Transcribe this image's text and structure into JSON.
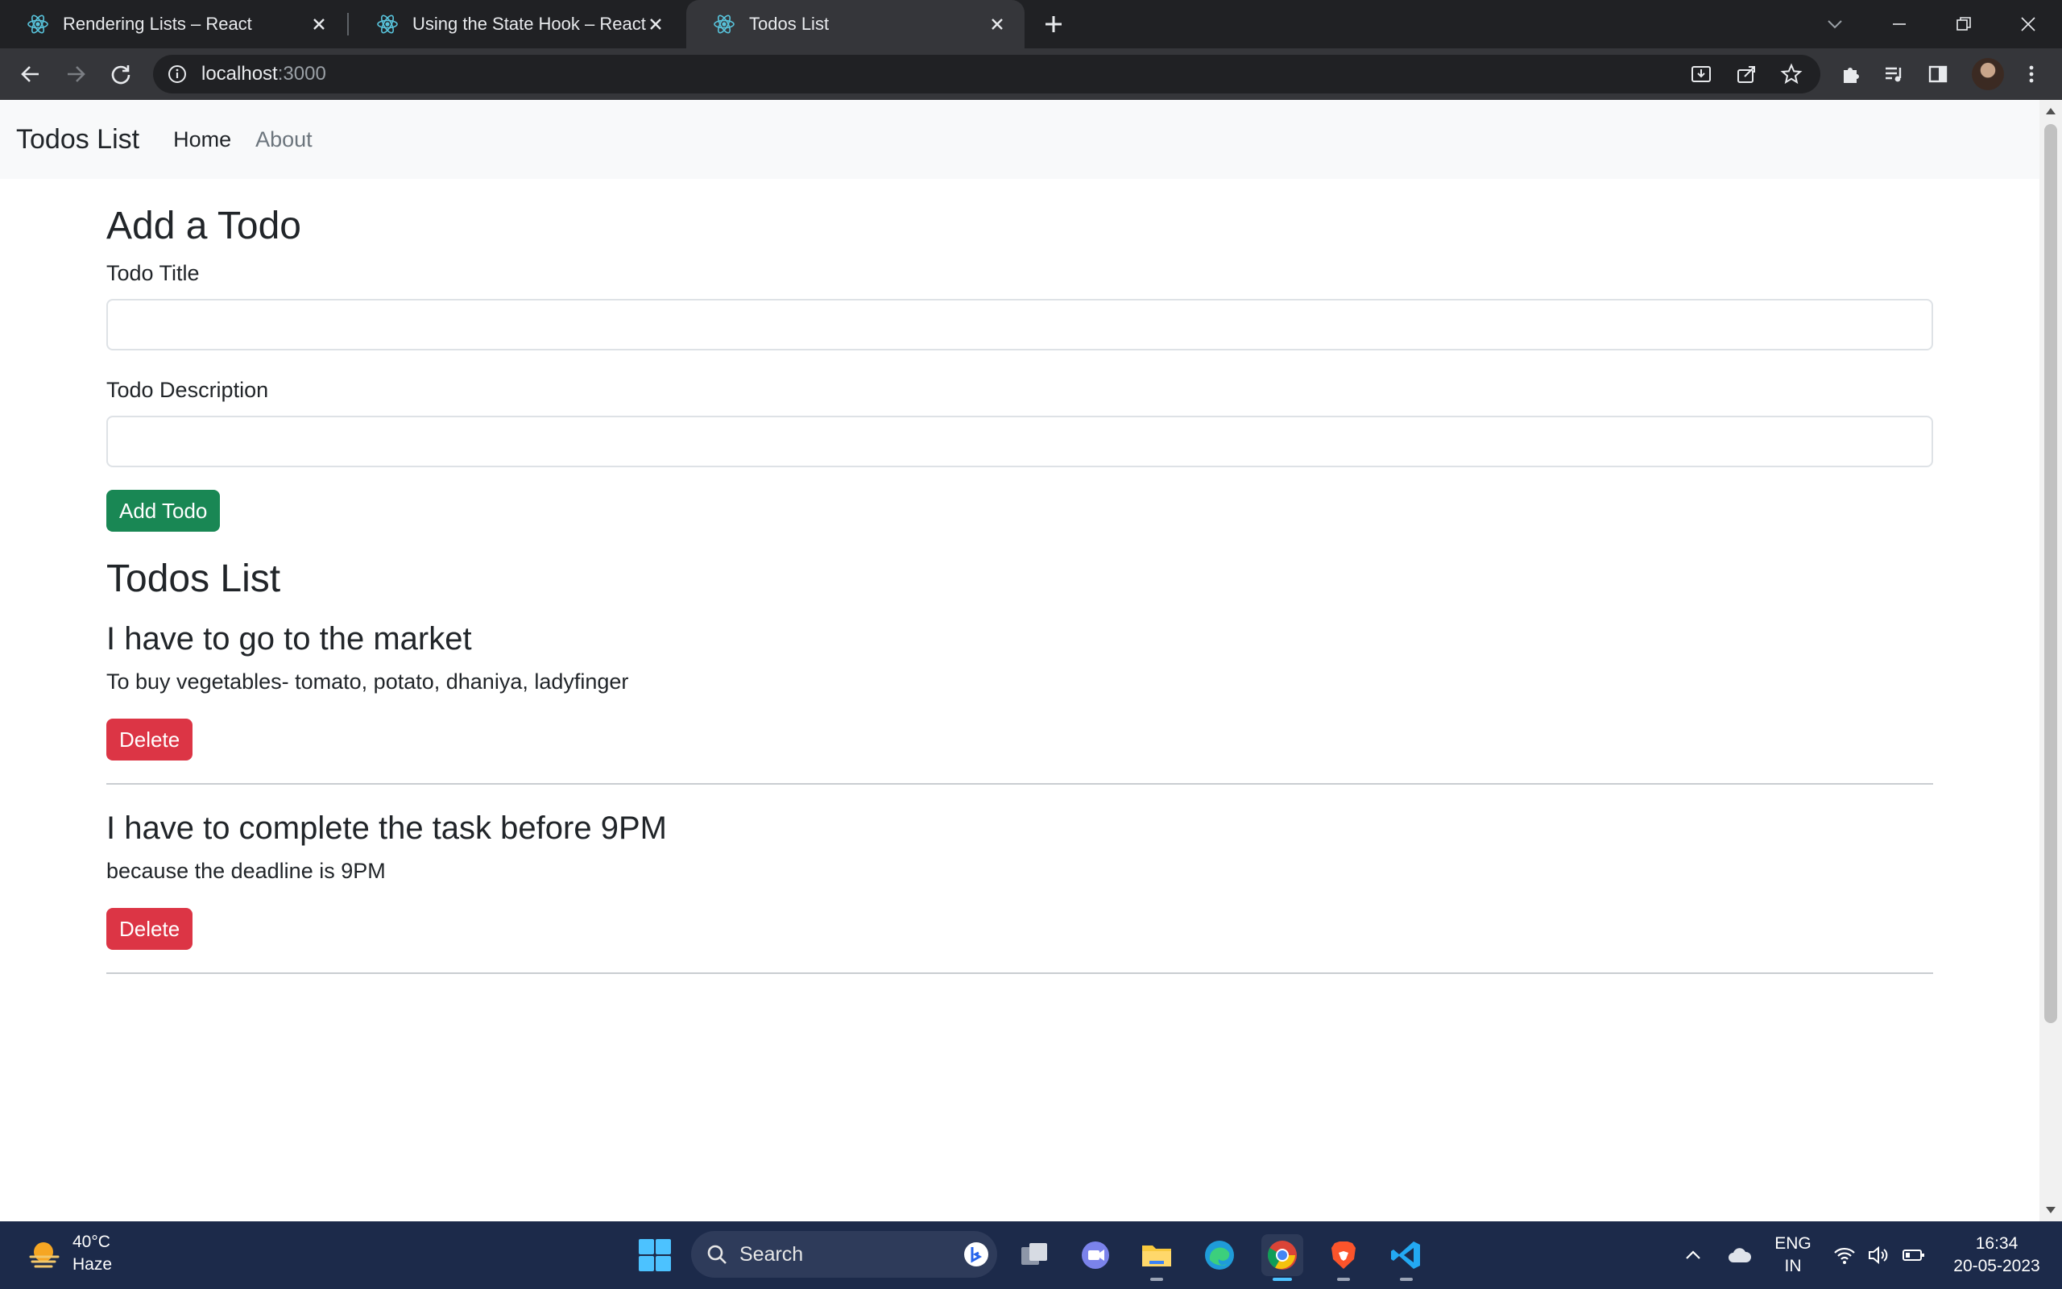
{
  "browser": {
    "tabs": [
      {
        "title": "Rendering Lists – React",
        "active": false
      },
      {
        "title": "Using the State Hook – React",
        "active": false
      },
      {
        "title": "Todos List",
        "active": true
      }
    ],
    "url_host": "localhost",
    "url_port": ":3000"
  },
  "navbar": {
    "brand": "Todos List",
    "links": [
      {
        "label": "Home",
        "active": true
      },
      {
        "label": "About",
        "active": false
      }
    ]
  },
  "add_form": {
    "heading": "Add a Todo",
    "title_label": "Todo Title",
    "title_value": "",
    "desc_label": "Todo Description",
    "desc_value": "",
    "submit_label": "Add Todo"
  },
  "todos_section": {
    "heading": "Todos List",
    "items": [
      {
        "title": "I have to go to the market",
        "desc": "To buy vegetables- tomato, potato, dhaniya, ladyfinger",
        "delete_label": "Delete"
      },
      {
        "title": "I have to complete the task before 9PM",
        "desc": "because the deadline is 9PM",
        "delete_label": "Delete"
      }
    ]
  },
  "taskbar": {
    "weather_temp": "40°C",
    "weather_cond": "Haze",
    "search_placeholder": "Search",
    "lang_top": "ENG",
    "lang_bottom": "IN",
    "time": "16:34",
    "date": "20-05-2023"
  },
  "colors": {
    "success": "#198754",
    "danger": "#dc3545",
    "navbar_bg": "#f8f9fa",
    "chrome_bg": "#202124"
  }
}
